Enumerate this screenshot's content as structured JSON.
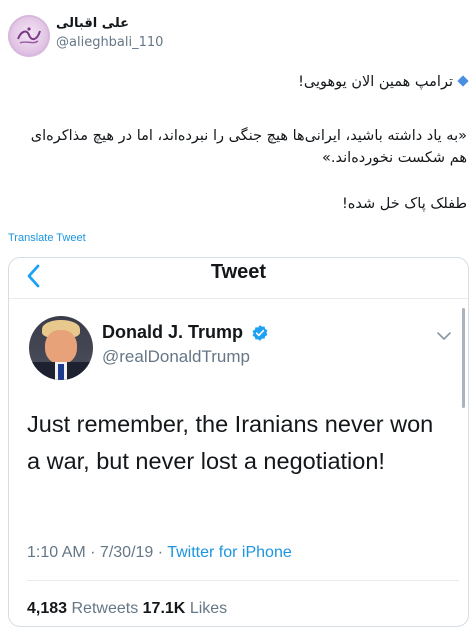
{
  "tweet": {
    "author_name": "علی اقبالی",
    "author_handle": "@alieghbali_110",
    "lines": [
      "ترامپ همین الان یوهویی!",
      "«به یاد داشته باشید، ایرانی‌ها هیچ جنگی را نبرده‌اند، اما در هیچ مذاکره‌ای هم شکست نخورده‌اند.»",
      "طفلک پاک خل شده!"
    ],
    "bullet_icon": "blue-diamond-icon",
    "translate_label": "Translate Tweet"
  },
  "embedded": {
    "header_title": "Tweet",
    "author_name": "Donald J. Trump",
    "author_handle": "@realDonaldTrump",
    "text": "Just remember, the Iranians never won a war, but never lost a negotiation!",
    "time": "1:10 AM · 7/30/19 · ",
    "source": "Twitter for iPhone",
    "retweets": "4,183",
    "retweets_label": "Retweets",
    "likes": "17.1K",
    "likes_label": "Likes"
  },
  "colors": {
    "link": "#1b95e0",
    "muted": "#657786",
    "verified": "#1da1f2"
  }
}
